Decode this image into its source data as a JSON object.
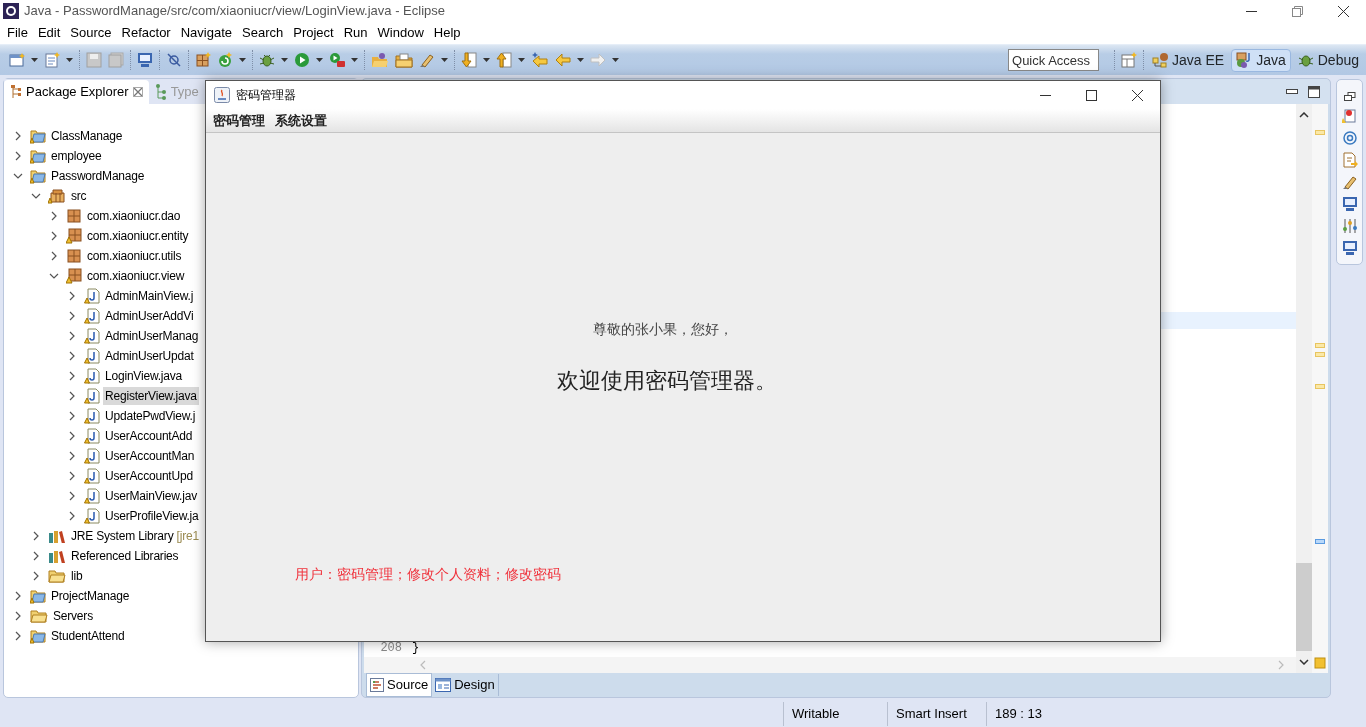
{
  "window": {
    "title": "Java - PasswordManage/src/com/xiaoniucr/view/LoginView.java - Eclipse"
  },
  "menu_bar": [
    "File",
    "Edit",
    "Source",
    "Refactor",
    "Navigate",
    "Search",
    "Project",
    "Run",
    "Window",
    "Help"
  ],
  "quick_access": {
    "placeholder": "Quick Access"
  },
  "perspectives": [
    {
      "label": "Java EE",
      "selected": false
    },
    {
      "label": "Java",
      "selected": true
    },
    {
      "label": "Debug",
      "selected": false
    }
  ],
  "package_explorer": {
    "tabs": [
      {
        "label": "Package Explorer",
        "selected": true
      },
      {
        "label": "Type",
        "selected": false
      }
    ],
    "tree": [
      {
        "kind": "project",
        "label": "ClassManage",
        "expanded": false,
        "selected": false
      },
      {
        "kind": "project",
        "label": "employee",
        "expanded": false,
        "selected": false
      },
      {
        "kind": "project",
        "label": "PasswordManage",
        "expanded": true,
        "selected": false,
        "children": [
          {
            "kind": "source",
            "label": "src",
            "expanded": true,
            "selected": false,
            "children": [
              {
                "kind": "package",
                "label": "com.xiaoniucr.dao",
                "expanded": false,
                "selected": false
              },
              {
                "kind": "package-warning",
                "label": "com.xiaoniucr.entity",
                "expanded": false,
                "selected": false
              },
              {
                "kind": "package",
                "label": "com.xiaoniucr.utils",
                "expanded": false,
                "selected": false
              },
              {
                "kind": "package-warning",
                "label": "com.xiaoniucr.view",
                "expanded": true,
                "selected": false,
                "children": [
                  {
                    "kind": "file",
                    "label": "AdminMainView.j",
                    "expanded": false,
                    "selected": false
                  },
                  {
                    "kind": "file",
                    "label": "AdminUserAddVi",
                    "expanded": false,
                    "selected": false
                  },
                  {
                    "kind": "file",
                    "label": "AdminUserManag",
                    "expanded": false,
                    "selected": false
                  },
                  {
                    "kind": "file",
                    "label": "AdminUserUpdat",
                    "expanded": false,
                    "selected": false
                  },
                  {
                    "kind": "file",
                    "label": "LoginView.java",
                    "expanded": false,
                    "selected": false
                  },
                  {
                    "kind": "file",
                    "label": "RegisterView.java",
                    "expanded": false,
                    "selected": true
                  },
                  {
                    "kind": "file",
                    "label": "UpdatePwdView.j",
                    "expanded": false,
                    "selected": false
                  },
                  {
                    "kind": "file",
                    "label": "UserAccountAdd",
                    "expanded": false,
                    "selected": false
                  },
                  {
                    "kind": "file",
                    "label": "UserAccountMan",
                    "expanded": false,
                    "selected": false
                  },
                  {
                    "kind": "file",
                    "label": "UserAccountUpd",
                    "expanded": false,
                    "selected": false
                  },
                  {
                    "kind": "file",
                    "label": "UserMainView.jav",
                    "expanded": false,
                    "selected": false
                  },
                  {
                    "kind": "file",
                    "label": "UserProfileView.ja",
                    "expanded": false,
                    "selected": false
                  }
                ]
              }
            ]
          },
          {
            "kind": "library",
            "label": "JRE System Library",
            "decoration": "[jre1",
            "expanded": false,
            "selected": false
          },
          {
            "kind": "library",
            "label": "Referenced Libraries",
            "expanded": false,
            "selected": false
          },
          {
            "kind": "folder",
            "label": "lib",
            "expanded": false,
            "selected": false
          }
        ]
      },
      {
        "kind": "project",
        "label": "ProjectManage",
        "expanded": false,
        "selected": false
      },
      {
        "kind": "folder",
        "label": "Servers",
        "expanded": false,
        "selected": false
      },
      {
        "kind": "project",
        "label": "StudentAttend",
        "expanded": false,
        "selected": false
      }
    ]
  },
  "editor": {
    "line_number": "208",
    "code": "}",
    "tabs": [
      {
        "label": "Source",
        "selected": true
      },
      {
        "label": "Design",
        "selected": false
      }
    ]
  },
  "status_bar": [
    "Writable",
    "Smart Insert",
    "189 : 13"
  ],
  "dialog": {
    "title": "密码管理器",
    "menus": [
      "密码管理",
      "系统设置"
    ],
    "greeting": "尊敬的张小果，您好，",
    "welcome": "欢迎使用密码管理器。",
    "permissions": "用户：密码管理；修改个人资料；修改密码"
  }
}
